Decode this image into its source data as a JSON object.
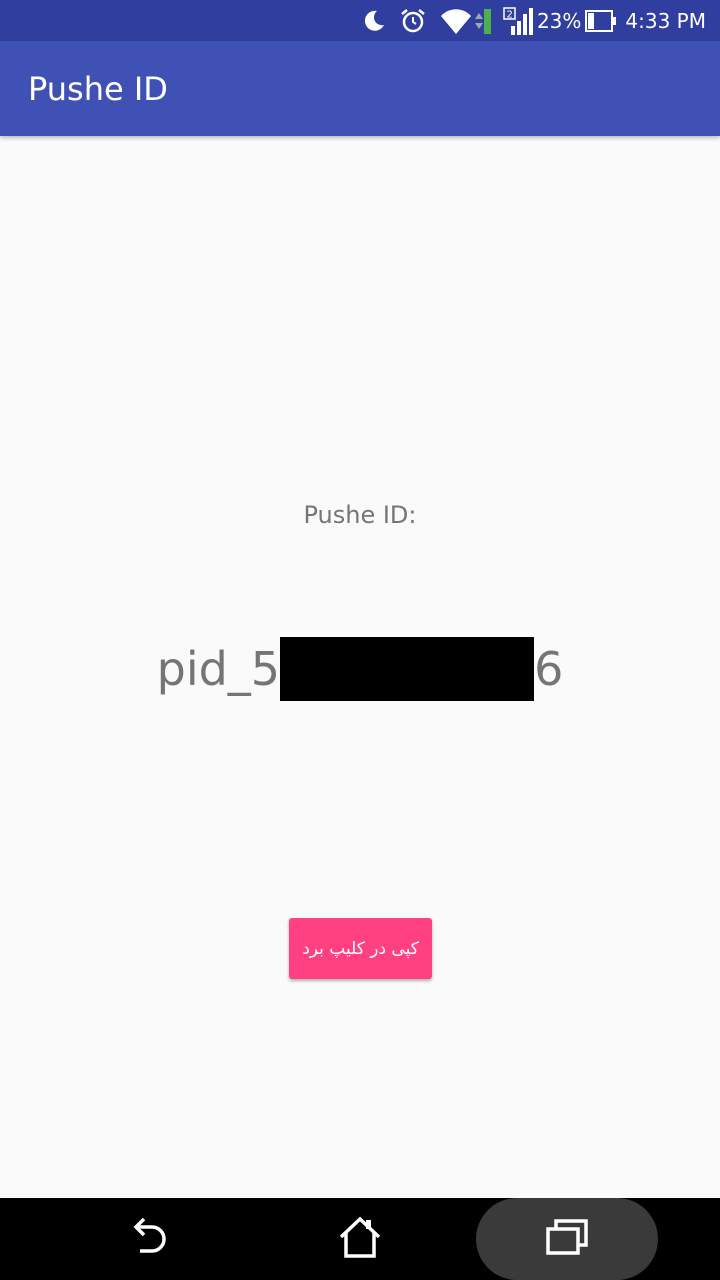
{
  "status_bar": {
    "battery_percent": "23%",
    "time": "4:33 PM",
    "sim_slot": "2",
    "icons": [
      "moon-icon",
      "alarm-icon",
      "wifi-icon",
      "signal-icon",
      "battery-icon"
    ]
  },
  "app_bar": {
    "title": "Pushe ID"
  },
  "main": {
    "id_label": "Pushe ID:",
    "id_prefix": "pid_5",
    "id_suffix": "6",
    "copy_button_label": "کپی در کلیپ برد"
  },
  "nav_bar": {
    "icons": [
      "back-icon",
      "home-icon",
      "recents-icon"
    ]
  },
  "colors": {
    "status_bar": "#303f9f",
    "app_bar": "#3f51b5",
    "accent": "#ff4081",
    "background": "#fafafa",
    "text_secondary": "#757575"
  }
}
